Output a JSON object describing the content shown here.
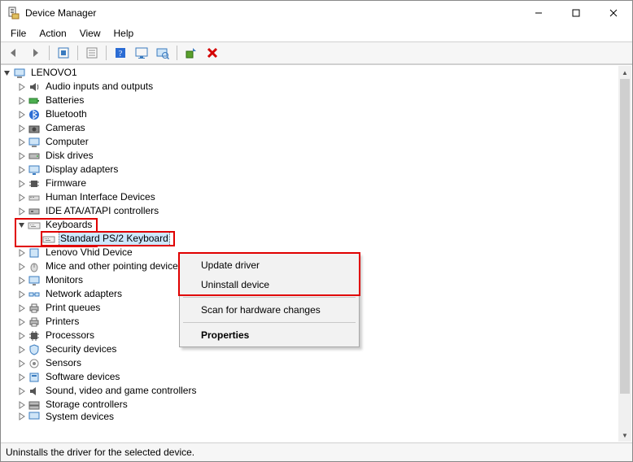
{
  "window": {
    "title": "Device Manager"
  },
  "menubar": [
    "File",
    "Action",
    "View",
    "Help"
  ],
  "toolbar": {
    "back_tip": "Back",
    "forward_tip": "Forward",
    "options_tip": "Options",
    "properties_tip": "Properties",
    "help_tip": "Help",
    "show_hidden_tip": "Show hidden devices",
    "scan_tip": "Scan for hardware changes",
    "add_legacy_tip": "Add legacy hardware",
    "uninstall_tip": "Uninstall device"
  },
  "tree": {
    "root": {
      "label": "LENOVO1",
      "expanded": true
    },
    "items": [
      {
        "key": "audio",
        "label": "Audio inputs and outputs",
        "expanded": false
      },
      {
        "key": "batteries",
        "label": "Batteries",
        "expanded": false
      },
      {
        "key": "bluetooth",
        "label": "Bluetooth",
        "expanded": false
      },
      {
        "key": "cameras",
        "label": "Cameras",
        "expanded": false
      },
      {
        "key": "computer",
        "label": "Computer",
        "expanded": false
      },
      {
        "key": "disks",
        "label": "Disk drives",
        "expanded": false
      },
      {
        "key": "display",
        "label": "Display adapters",
        "expanded": false
      },
      {
        "key": "firmware",
        "label": "Firmware",
        "expanded": false
      },
      {
        "key": "hid",
        "label": "Human Interface Devices",
        "expanded": false
      },
      {
        "key": "ide",
        "label": "IDE ATA/ATAPI controllers",
        "expanded": false
      },
      {
        "key": "keyboards",
        "label": "Keyboards",
        "expanded": true,
        "children": [
          {
            "key": "ps2kbd",
            "label": "Standard PS/2 Keyboard",
            "selected": true
          }
        ]
      },
      {
        "key": "lenovovhid",
        "label": "Lenovo Vhid Device",
        "expanded": false
      },
      {
        "key": "mice",
        "label": "Mice and other pointing devices",
        "expanded": false
      },
      {
        "key": "monitors",
        "label": "Monitors",
        "expanded": false
      },
      {
        "key": "network",
        "label": "Network adapters",
        "expanded": false
      },
      {
        "key": "printq",
        "label": "Print queues",
        "expanded": false
      },
      {
        "key": "printers",
        "label": "Printers",
        "expanded": false
      },
      {
        "key": "processors",
        "label": "Processors",
        "expanded": false
      },
      {
        "key": "security",
        "label": "Security devices",
        "expanded": false
      },
      {
        "key": "sensors",
        "label": "Sensors",
        "expanded": false
      },
      {
        "key": "software",
        "label": "Software devices",
        "expanded": false
      },
      {
        "key": "sound",
        "label": "Sound, video and game controllers",
        "expanded": false
      },
      {
        "key": "storctrl",
        "label": "Storage controllers",
        "expanded": false
      },
      {
        "key": "sysdev",
        "label": "System devices",
        "expanded": false
      }
    ]
  },
  "context_menu": {
    "update": "Update driver",
    "uninstall": "Uninstall device",
    "scan": "Scan for hardware changes",
    "properties": "Properties"
  },
  "statusbar": {
    "text": "Uninstalls the driver for the selected device."
  },
  "highlights": {
    "keyboards_row": true,
    "ps2_row": true,
    "ctx_top_two": true
  }
}
